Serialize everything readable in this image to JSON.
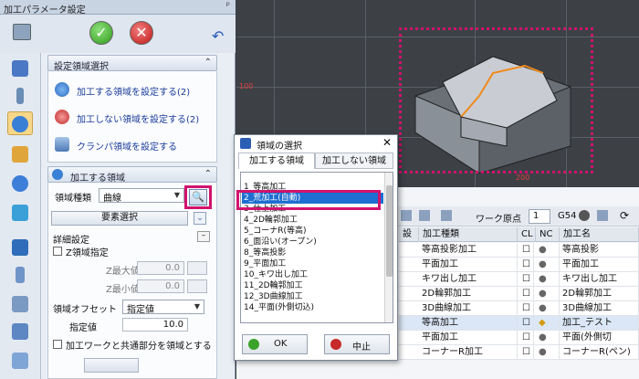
{
  "panel": {
    "title": "加工パラメータ設定",
    "pin": "ᵖ"
  },
  "colors": {
    "highlight": "#d1126d",
    "selection": "#1e6ed1",
    "link": "#1a3c9a"
  },
  "area_section": {
    "header": "設定領域選択",
    "items": [
      "加工する領域を設定する(2)",
      "加工しない領域を設定する(2)",
      "クランパ領域を設定する"
    ]
  },
  "machining_area": {
    "header": "加工する領域",
    "type_label": "領域種類",
    "type_value": "曲線",
    "element_select": "要素選択",
    "detail_label": "詳細設定",
    "z_spec_label": "Z領域指定",
    "z_max_label": "Z最大値",
    "z_max_value": "0.0",
    "z_min_label": "Z最小値",
    "z_min_value": "0.0",
    "offset_label": "領域オフセット",
    "offset_mode": "指定値",
    "spec_label": "指定値",
    "spec_value": "10.0",
    "common_label": "加工ワークと共通部分を領域とする"
  },
  "viewport": {
    "label_100": "100",
    "label_200": "200"
  },
  "toolbar": {
    "work_origin_label": "ワーク原点",
    "work_origin_value": "1",
    "g54": "G54"
  },
  "table": {
    "headers": [
      "設定",
      "加工種類",
      "CL",
      "NC",
      "加工名"
    ],
    "rows": [
      {
        "type": "等高投影加工",
        "name": "等高投影"
      },
      {
        "type": "平面加工",
        "name": "平面加工"
      },
      {
        "type": "キワ出し加工",
        "name": "キワ出し加工"
      },
      {
        "type": "2D輪郭加工",
        "name": "2D輪郭加工"
      },
      {
        "type": "3D曲線加工",
        "name": "3D曲線加工"
      },
      {
        "type": "等高加工",
        "name": "加工_テスト"
      },
      {
        "type": "平面加工",
        "name": "平面(外側切"
      },
      {
        "type": "コーナーR加工",
        "name": "コーナーR(ペン)"
      }
    ]
  },
  "dialog": {
    "title": "領域の選択",
    "tabs": [
      "加工する領域",
      "加工しない領域"
    ],
    "items": [
      "1_等高加工",
      "2_荒加工(自動)",
      "3_仕上加工",
      "4_2D輪郭加工",
      "5_コーナR(等高)",
      "6_面沿い(オープン)",
      "8_等高投影",
      "9_平面加工",
      "10_キワ出し加工",
      "11_2D輪郭加工",
      "12_3D曲線加工",
      "14_平面(外側切込)"
    ],
    "ok": "OK",
    "cancel": "中止"
  }
}
